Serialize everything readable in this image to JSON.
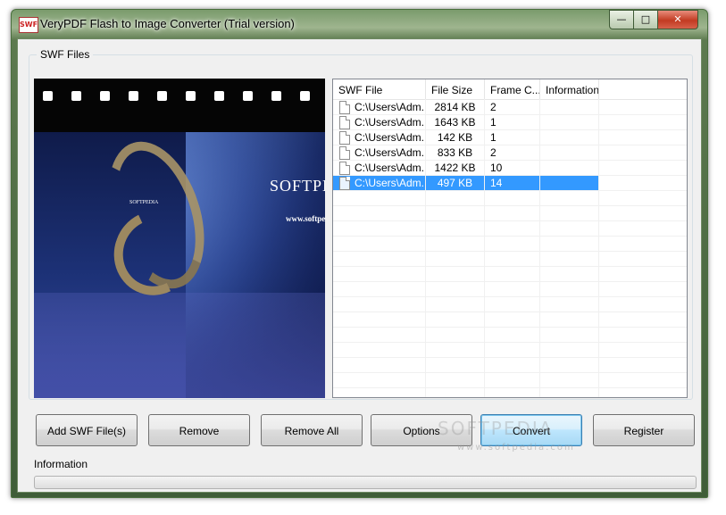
{
  "window": {
    "icon_text": "SWF",
    "title": "VeryPDF Flash to Image Converter (Trial version)",
    "minimize_glyph": "—",
    "maximize_glyph": "□",
    "close_glyph": "✕"
  },
  "group": {
    "label": "SWF Files"
  },
  "preview": {
    "logo_text": "SOFTPEDIA",
    "url_text": "www.softpedia",
    "small_text": "SOFTPEDIA"
  },
  "list": {
    "columns": [
      "SWF File",
      "File Size",
      "Frame C...",
      "Information"
    ],
    "rows": [
      {
        "file": "C:\\Users\\Adm...",
        "size": "2814 KB",
        "frames": "2",
        "info": ""
      },
      {
        "file": "C:\\Users\\Adm...",
        "size": "1643 KB",
        "frames": "1",
        "info": ""
      },
      {
        "file": "C:\\Users\\Adm...",
        "size": "142 KB",
        "frames": "1",
        "info": ""
      },
      {
        "file": "C:\\Users\\Adm...",
        "size": "833 KB",
        "frames": "2",
        "info": ""
      },
      {
        "file": "C:\\Users\\Adm...",
        "size": "1422 KB",
        "frames": "10",
        "info": ""
      },
      {
        "file": "C:\\Users\\Adm...",
        "size": "497 KB",
        "frames": "14",
        "info": ""
      }
    ],
    "selected_index": 5
  },
  "buttons": {
    "add": "Add SWF File(s)",
    "remove": "Remove",
    "remove_all": "Remove All",
    "options": "Options",
    "convert": "Convert",
    "register": "Register"
  },
  "watermark": {
    "text": "SOFTPEDIA",
    "url": "www.softpedia.com"
  },
  "info": {
    "label": "Information",
    "progress": 0
  }
}
